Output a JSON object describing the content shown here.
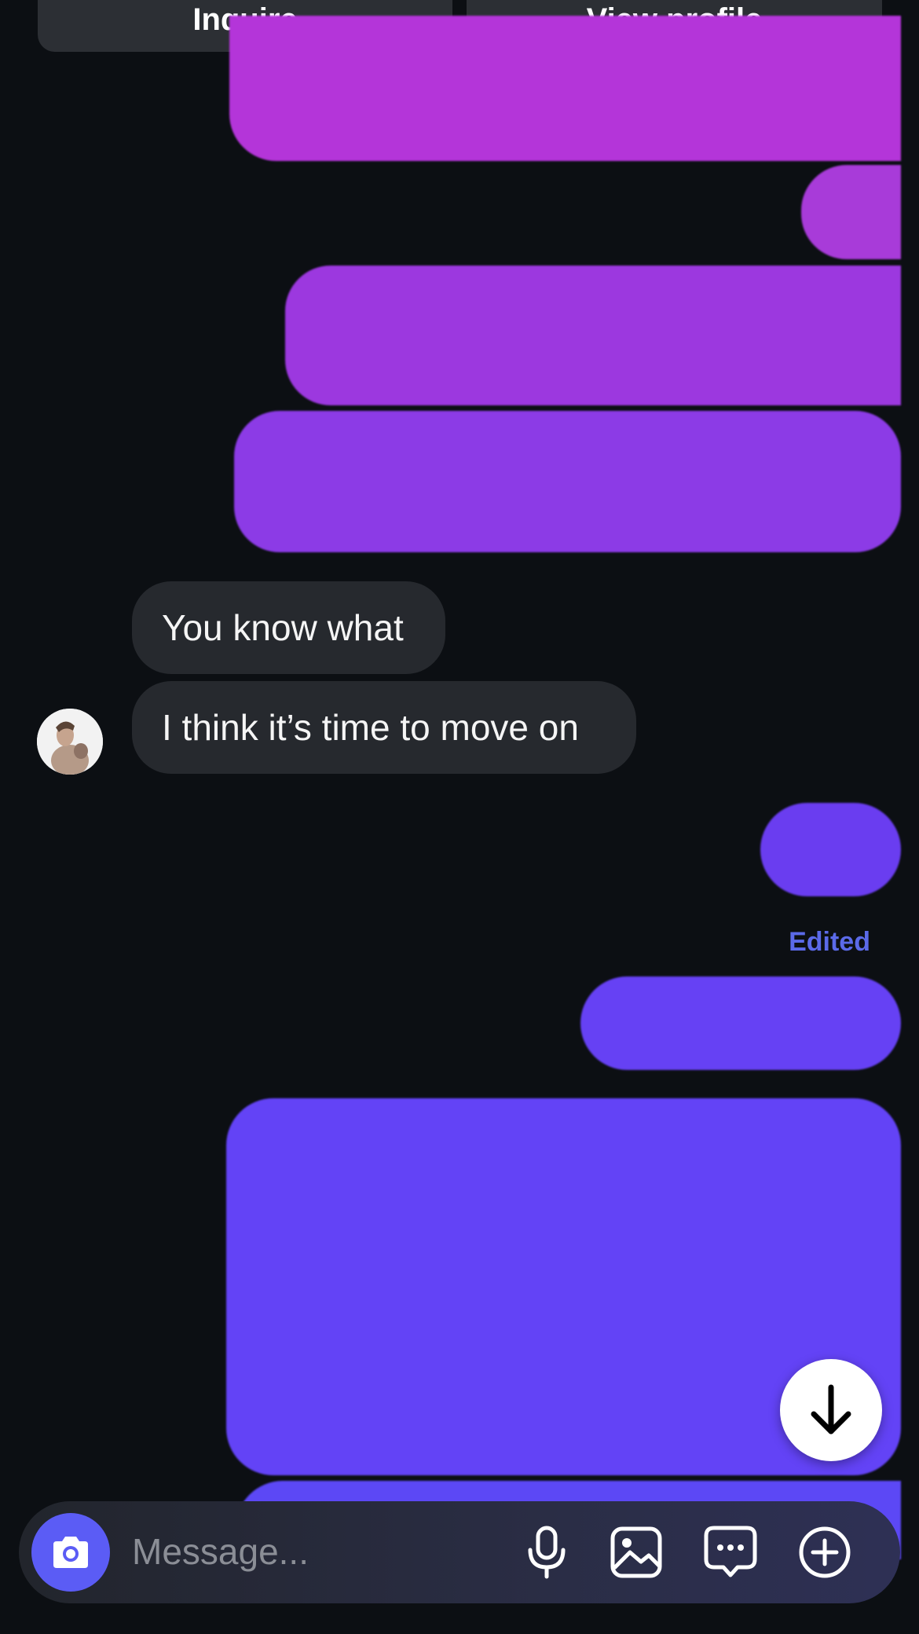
{
  "header": {
    "inquire_label": "Inquire",
    "view_profile_label": "View profile"
  },
  "messages": {
    "incoming": [
      "You know what",
      "I think it’s time to move on"
    ],
    "edited_label": "Edited"
  },
  "composer": {
    "placeholder": "Message..."
  },
  "icons": {
    "camera": "camera-icon",
    "microphone": "microphone-icon",
    "gallery": "image-icon",
    "sticker": "chat-bubble-icon",
    "add": "plus-circle-icon",
    "scroll_down": "arrow-down-icon"
  },
  "colors": {
    "background": "#0c0f13",
    "incoming_bubble": "#26292e",
    "outgoing_top": "#b334d8",
    "outgoing_bottom": "#5b46f5",
    "accent": "#5b5cf5",
    "edited": "#5b6ae8"
  }
}
